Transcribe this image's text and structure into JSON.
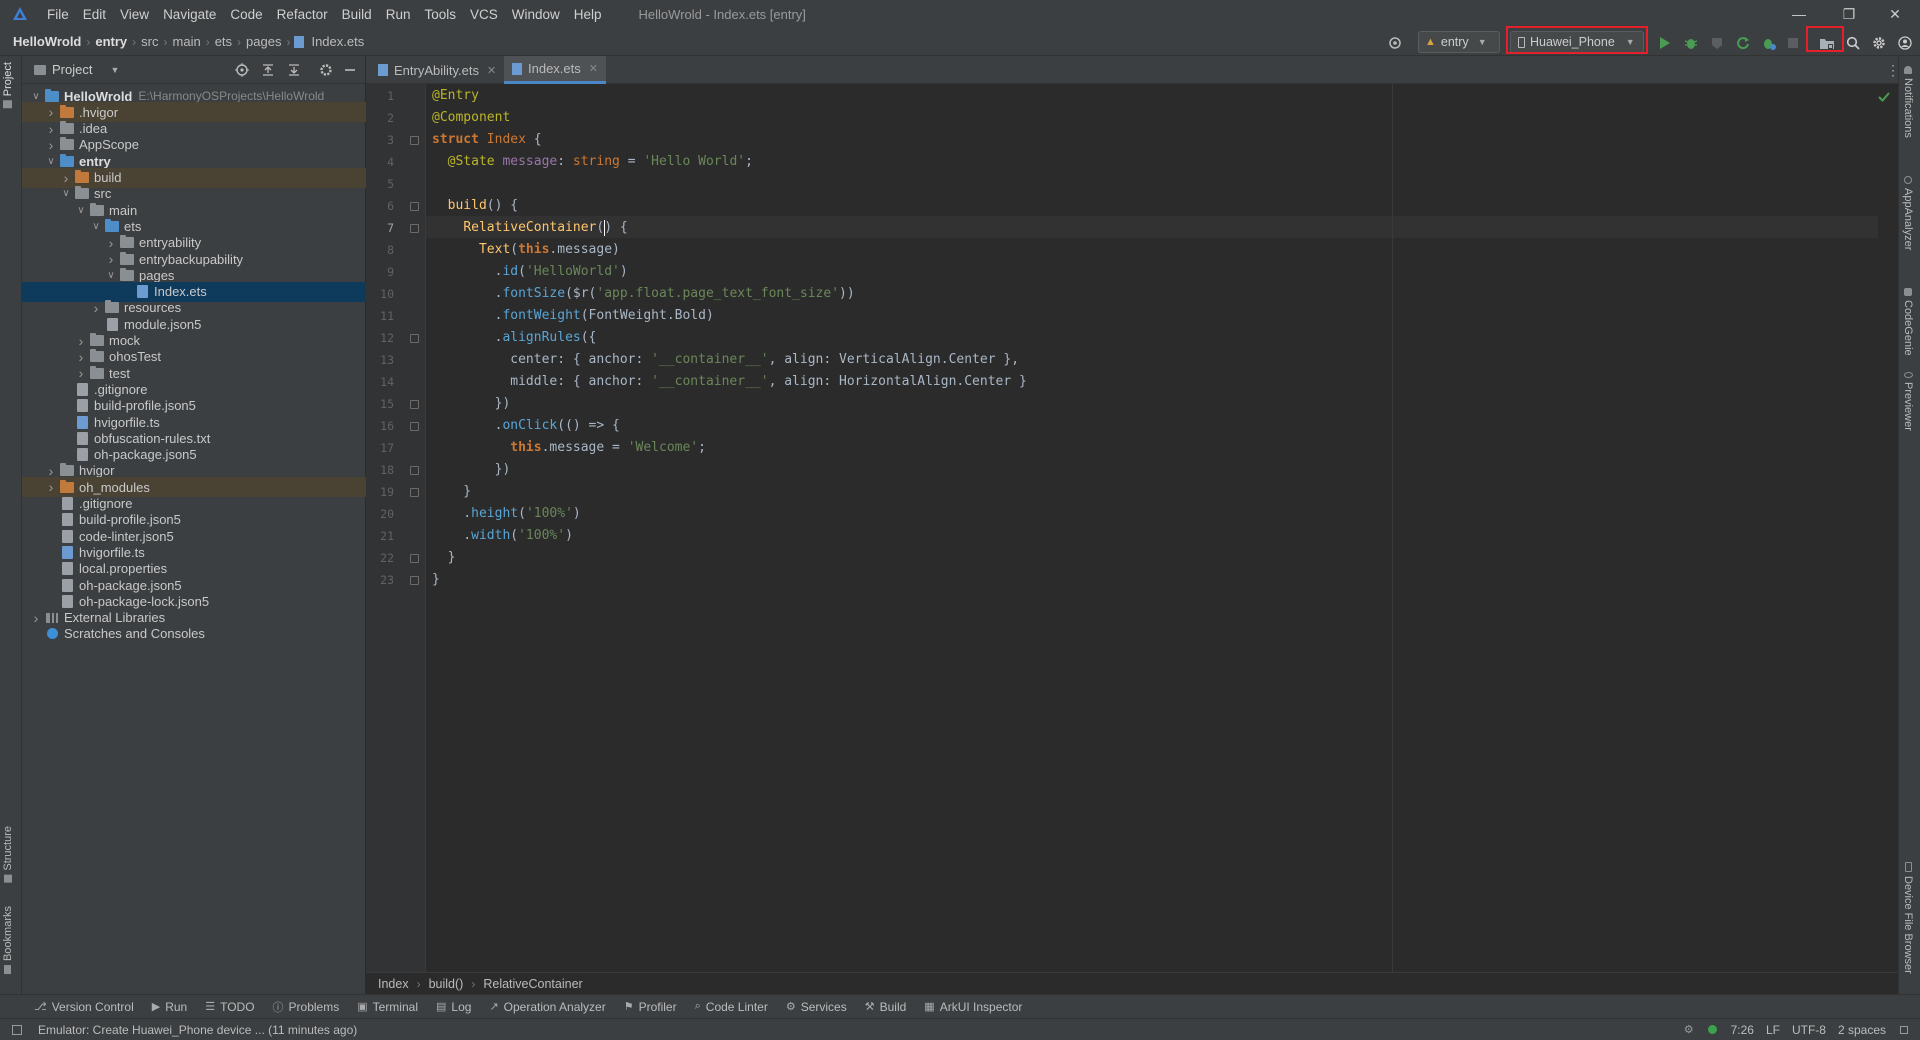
{
  "window": {
    "menu": [
      "File",
      "Edit",
      "View",
      "Navigate",
      "Code",
      "Refactor",
      "Build",
      "Run",
      "Tools",
      "VCS",
      "Window",
      "Help"
    ],
    "title": "HelloWrold - Index.ets [entry]"
  },
  "breadcrumb": [
    "HelloWrold",
    "entry",
    "src",
    "main",
    "ets",
    "pages",
    "Index.ets"
  ],
  "toolbar": {
    "module_select": "entry",
    "device_select": "Huawei_Phone"
  },
  "project_panel": {
    "title": "Project",
    "tree": [
      {
        "label": "HelloWrold",
        "extra": "E:\\HarmonyOSProjects\\HelloWrold",
        "depth": 0,
        "open": true,
        "kind": "folder-blue",
        "bold": true
      },
      {
        "label": ".hvigor",
        "depth": 1,
        "open": false,
        "kind": "folder-orange",
        "hl": true
      },
      {
        "label": ".idea",
        "depth": 1,
        "open": false,
        "kind": "folder"
      },
      {
        "label": "AppScope",
        "depth": 1,
        "open": false,
        "kind": "folder"
      },
      {
        "label": "entry",
        "depth": 1,
        "open": true,
        "kind": "folder-blue",
        "bold": true
      },
      {
        "label": "build",
        "depth": 2,
        "open": false,
        "kind": "folder-orange",
        "hl": true
      },
      {
        "label": "src",
        "depth": 2,
        "open": true,
        "kind": "folder"
      },
      {
        "label": "main",
        "depth": 3,
        "open": true,
        "kind": "folder"
      },
      {
        "label": "ets",
        "depth": 4,
        "open": true,
        "kind": "folder-blue"
      },
      {
        "label": "entryability",
        "depth": 5,
        "open": false,
        "kind": "folder"
      },
      {
        "label": "entrybackupability",
        "depth": 5,
        "open": false,
        "kind": "folder"
      },
      {
        "label": "pages",
        "depth": 5,
        "open": true,
        "kind": "folder"
      },
      {
        "label": "Index.ets",
        "depth": 6,
        "kind": "file-ets",
        "sel": true
      },
      {
        "label": "resources",
        "depth": 4,
        "open": false,
        "kind": "folder"
      },
      {
        "label": "module.json5",
        "depth": 4,
        "kind": "file"
      },
      {
        "label": "mock",
        "depth": 3,
        "open": false,
        "kind": "folder"
      },
      {
        "label": "ohosTest",
        "depth": 3,
        "open": false,
        "kind": "folder"
      },
      {
        "label": "test",
        "depth": 3,
        "open": false,
        "kind": "folder"
      },
      {
        "label": ".gitignore",
        "depth": 2,
        "kind": "file"
      },
      {
        "label": "build-profile.json5",
        "depth": 2,
        "kind": "file"
      },
      {
        "label": "hvigorfile.ts",
        "depth": 2,
        "kind": "file-ets"
      },
      {
        "label": "obfuscation-rules.txt",
        "depth": 2,
        "kind": "file"
      },
      {
        "label": "oh-package.json5",
        "depth": 2,
        "kind": "file"
      },
      {
        "label": "hvigor",
        "depth": 1,
        "open": false,
        "kind": "folder"
      },
      {
        "label": "oh_modules",
        "depth": 1,
        "open": false,
        "kind": "folder-orange",
        "hl": true
      },
      {
        "label": ".gitignore",
        "depth": 1,
        "kind": "file"
      },
      {
        "label": "build-profile.json5",
        "depth": 1,
        "kind": "file"
      },
      {
        "label": "code-linter.json5",
        "depth": 1,
        "kind": "file"
      },
      {
        "label": "hvigorfile.ts",
        "depth": 1,
        "kind": "file-ets"
      },
      {
        "label": "local.properties",
        "depth": 1,
        "kind": "file"
      },
      {
        "label": "oh-package.json5",
        "depth": 1,
        "kind": "file"
      },
      {
        "label": "oh-package-lock.json5",
        "depth": 1,
        "kind": "file"
      },
      {
        "label": "External Libraries",
        "depth": 0,
        "open": false,
        "kind": "libs"
      },
      {
        "label": "Scratches and Consoles",
        "depth": 0,
        "kind": "scratch"
      }
    ]
  },
  "left_strip": {
    "project": "Project",
    "structure": "Structure",
    "bookmarks": "Bookmarks"
  },
  "right_strip": {
    "notifications": "Notifications",
    "appanalyzer": "AppAnalyzer",
    "codegenie": "CodeGenie",
    "previewer": "Previewer",
    "devicefile": "Device File Browser"
  },
  "editor_tabs": [
    {
      "label": "EntryAbility.ets",
      "active": false
    },
    {
      "label": "Index.ets",
      "active": true
    }
  ],
  "editor": {
    "current_line": 7,
    "lines": [
      [
        [
          "an",
          "@Entry"
        ]
      ],
      [
        [
          "an",
          "@Component"
        ]
      ],
      [
        [
          "kw",
          "struct "
        ],
        [
          "ty",
          "Index "
        ],
        [
          "nm",
          "{"
        ]
      ],
      [
        [
          "nm",
          "  "
        ],
        [
          "an",
          "@State "
        ],
        [
          "pu",
          "message"
        ],
        [
          "nm",
          ": "
        ],
        [
          "ty",
          "string "
        ],
        [
          "nm",
          "= "
        ],
        [
          "st",
          "'Hello World'"
        ],
        [
          "nm",
          ";"
        ]
      ],
      [],
      [
        [
          "nm",
          "  "
        ],
        [
          "fn",
          "build"
        ],
        [
          "nm",
          "() {"
        ]
      ],
      [
        [
          "nm",
          "    "
        ],
        [
          "fn",
          "RelativeContainer"
        ],
        [
          "nm",
          "() {"
        ]
      ],
      [
        [
          "nm",
          "      "
        ],
        [
          "fn",
          "Text"
        ],
        [
          "nm",
          "("
        ],
        [
          "kw",
          "this"
        ],
        [
          "nm",
          ".message)"
        ]
      ],
      [
        [
          "nm",
          "        ."
        ],
        [
          "mth",
          "id"
        ],
        [
          "nm",
          "("
        ],
        [
          "st",
          "'HelloWorld'"
        ],
        [
          "nm",
          ")"
        ]
      ],
      [
        [
          "nm",
          "        ."
        ],
        [
          "mth",
          "fontSize"
        ],
        [
          "nm",
          "($r("
        ],
        [
          "st",
          "'app.float.page_text_font_size'"
        ],
        [
          "nm",
          "))"
        ]
      ],
      [
        [
          "nm",
          "        ."
        ],
        [
          "mth",
          "fontWeight"
        ],
        [
          "nm",
          "(FontWeight.Bold)"
        ]
      ],
      [
        [
          "nm",
          "        ."
        ],
        [
          "mth",
          "alignRules"
        ],
        [
          "nm",
          "({"
        ]
      ],
      [
        [
          "nm",
          "          center: { anchor: "
        ],
        [
          "st",
          "'__container__'"
        ],
        [
          "nm",
          ", align: VerticalAlign.Center },"
        ]
      ],
      [
        [
          "nm",
          "          middle: { anchor: "
        ],
        [
          "st",
          "'__container__'"
        ],
        [
          "nm",
          ", align: HorizontalAlign.Center }"
        ]
      ],
      [
        [
          "nm",
          "        })"
        ]
      ],
      [
        [
          "nm",
          "        ."
        ],
        [
          "mth",
          "onClick"
        ],
        [
          "nm",
          "(() => {"
        ]
      ],
      [
        [
          "nm",
          "          "
        ],
        [
          "kw",
          "this"
        ],
        [
          "nm",
          ".message = "
        ],
        [
          "st",
          "'Welcome'"
        ],
        [
          "nm",
          ";"
        ]
      ],
      [
        [
          "nm",
          "        })"
        ]
      ],
      [
        [
          "nm",
          "    }"
        ]
      ],
      [
        [
          "nm",
          "    ."
        ],
        [
          "mth",
          "height"
        ],
        [
          "nm",
          "("
        ],
        [
          "st",
          "'100%'"
        ],
        [
          "nm",
          ")"
        ]
      ],
      [
        [
          "nm",
          "    ."
        ],
        [
          "mth",
          "width"
        ],
        [
          "nm",
          "("
        ],
        [
          "st",
          "'100%'"
        ],
        [
          "nm",
          ")"
        ]
      ],
      [
        [
          "nm",
          "  }"
        ]
      ],
      [
        [
          "nm",
          "}"
        ]
      ]
    ]
  },
  "editor_breadcrumb": [
    "Index",
    "build()",
    "RelativeContainer"
  ],
  "tool_windows": [
    "Version Control",
    "Run",
    "TODO",
    "Problems",
    "Terminal",
    "Log",
    "Operation Analyzer",
    "Profiler",
    "Code Linter",
    "Services",
    "Build",
    "ArkUI Inspector"
  ],
  "status": {
    "message": "Emulator: Create Huawei_Phone device ... (11 minutes ago)",
    "position": "7:26",
    "line_sep": "LF",
    "encoding": "UTF-8",
    "indent": "2 spaces"
  },
  "colors": {
    "accent": "#4a88c7",
    "highlight_box": "#e5202a",
    "run_green": "#499c54"
  }
}
